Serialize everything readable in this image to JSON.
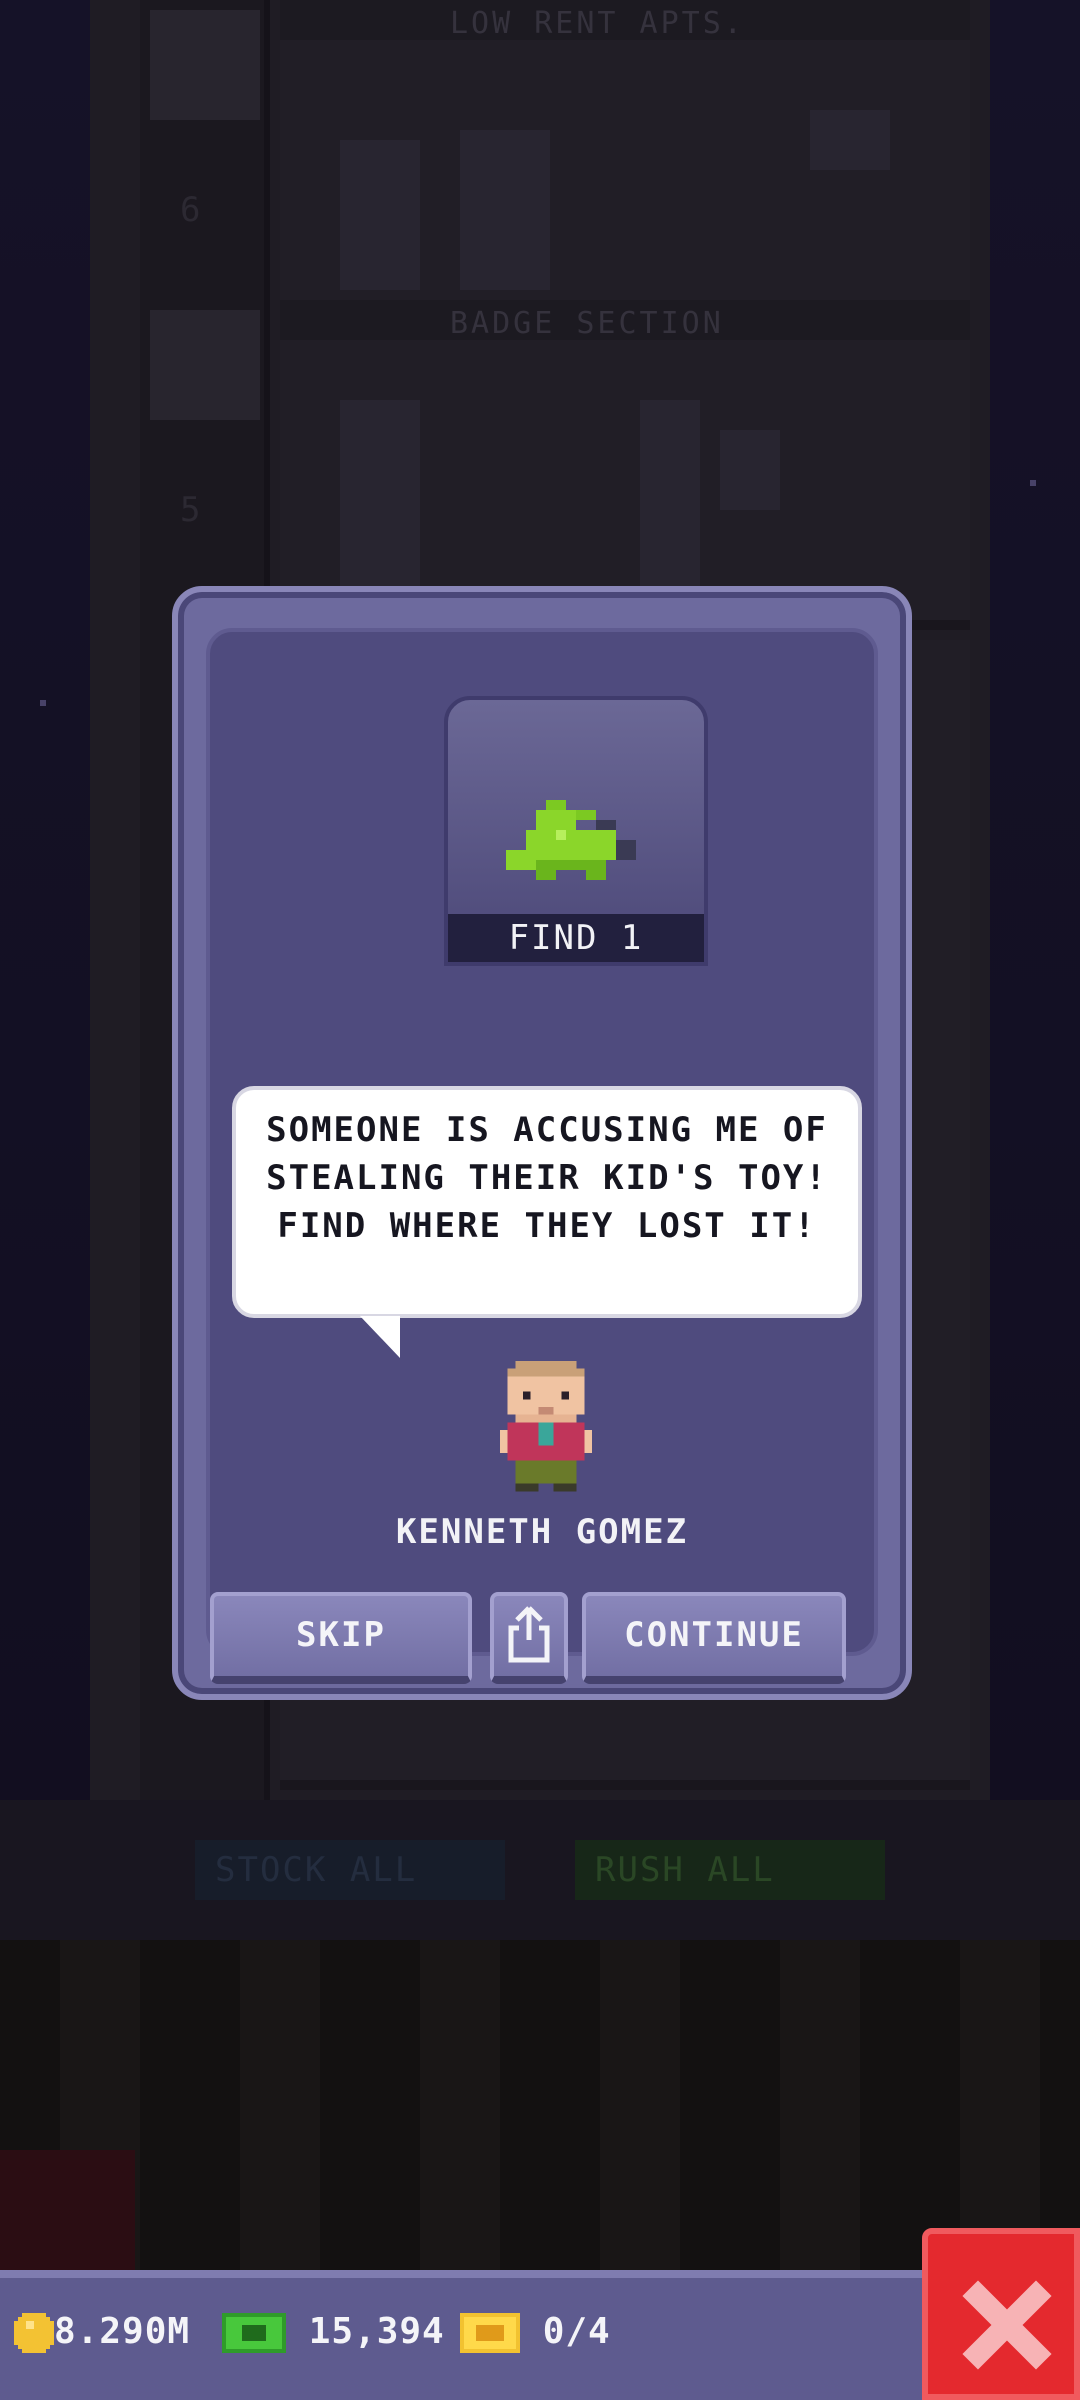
{
  "tower": {
    "floor_titles": [
      "LOW RENT APTS.",
      "BADGE SECTION"
    ],
    "floor_numbers": [
      "6",
      "5"
    ],
    "ground_buttons": {
      "stock_all": "STOCK ALL",
      "rush_all": "RUSH ALL"
    }
  },
  "mission": {
    "task_label": "FIND 1",
    "task_icon": "green-stegosaurus-toy-icon",
    "speech": "SOMEONE IS ACCUSING ME OF STEALING THEIR KID'S TOY! FIND WHERE THEY LOST IT!",
    "npc_name": "KENNETH GOMEZ",
    "buttons": {
      "skip": "SKIP",
      "share_icon": "share-icon",
      "continue": "CONTINUE"
    }
  },
  "currency": {
    "coins": "8.290M",
    "bux": "15,394",
    "tickets": "0/4"
  },
  "colors": {
    "dialog_bg": "#4f4b7e",
    "button_bg": "#7f7cb0",
    "close_red": "#e4292e",
    "toy_green": "#8bd62a"
  }
}
